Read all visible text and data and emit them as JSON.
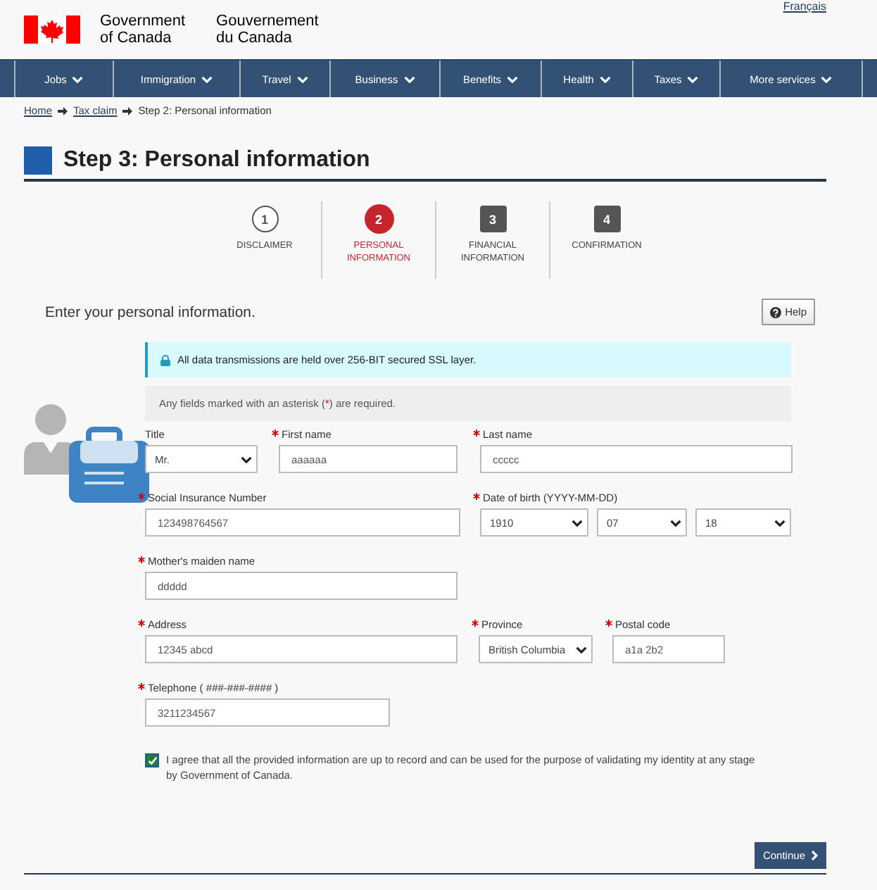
{
  "header": {
    "language_link": "Français",
    "government_en": [
      "Government",
      "of Canada"
    ],
    "government_fr": [
      "Gouvernement",
      "du Canada"
    ]
  },
  "nav": [
    {
      "label": "Jobs"
    },
    {
      "label": "Immigration"
    },
    {
      "label": "Travel"
    },
    {
      "label": "Business"
    },
    {
      "label": "Benefits"
    },
    {
      "label": "Health"
    },
    {
      "label": "Taxes"
    },
    {
      "label": "More services"
    }
  ],
  "breadcrumb": [
    {
      "label": "Home",
      "link": true
    },
    {
      "label": "Tax claim",
      "link": true
    },
    {
      "label": "Step 2: Personal information",
      "link": false
    }
  ],
  "page_title": "Step 3: Personal information",
  "steps": [
    {
      "number": "1",
      "label": "DISCLAIMER",
      "kind": "done"
    },
    {
      "number": "2",
      "label": "PERSONAL INFORMATION",
      "kind": "current"
    },
    {
      "number": "3",
      "label": "FINANCIAL INFORMATION",
      "kind": "upcoming"
    },
    {
      "number": "4",
      "label": "CONFIRMATION",
      "kind": "upcoming"
    }
  ],
  "intro": "Enter your personal information.",
  "help_button": "Help",
  "security_notice": "All data transmissions are held over 256-BIT secured SSL layer.",
  "required_note": {
    "before": "Any fields marked with an asterisk (",
    "mark": "*",
    "after": ") are required."
  },
  "form_rows": [
    [
      {
        "kind": "select",
        "label": "Title",
        "required": false,
        "value": "Mr."
      },
      {
        "kind": "text",
        "label": "First name",
        "required": true,
        "value": "aaaaaa"
      },
      {
        "kind": "text",
        "label": "Last name",
        "required": true,
        "value": "ccccc"
      }
    ],
    [
      {
        "kind": "text",
        "label": "Social Insurance Number",
        "required": true,
        "value": "123498764567"
      },
      {
        "kind": "date",
        "label": "Date of birth (YYYY-MM-DD)",
        "required": true,
        "values": [
          "1910",
          "07",
          "18"
        ]
      }
    ],
    [
      {
        "kind": "text",
        "label": "Mother's maiden name",
        "required": true,
        "value": "ddddd"
      }
    ],
    [
      {
        "kind": "text",
        "label": "Address",
        "required": true,
        "value": "12345 abcd"
      },
      {
        "kind": "select",
        "label": "Province",
        "required": true,
        "value": "British Columbia"
      },
      {
        "kind": "text",
        "label": "Postal code",
        "required": true,
        "value": "a1a 2b2"
      }
    ],
    [
      {
        "kind": "text",
        "label": "Telephone ( *###-###-####* )",
        "required": true,
        "value": "3211234567"
      }
    ]
  ],
  "agreement": {
    "checked": true,
    "text": "I agree that all the provided information are up to record and can be used for the purpose of validating my identity at any stage by Government of Canada."
  },
  "continue_button": "Continue"
}
